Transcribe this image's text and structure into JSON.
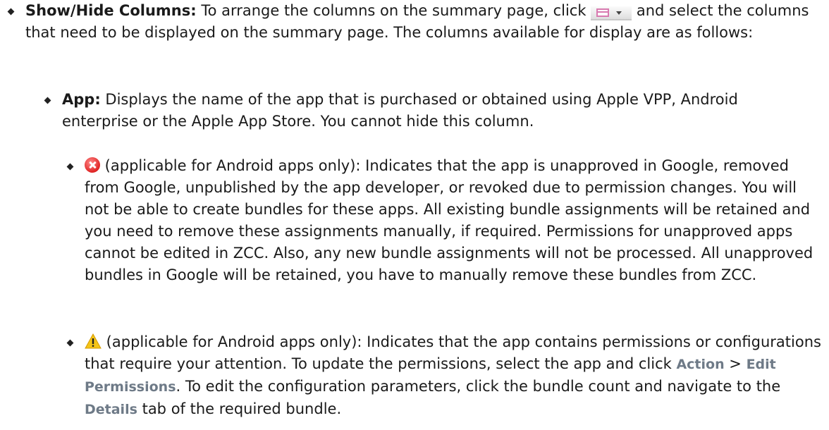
{
  "item1": {
    "term": "Show/Hide Columns:",
    "text_before_icon": " To arrange the columns on the summary page, click ",
    "text_after_icon": " and select the columns that need to be displayed on the summary page. The columns available for display are as follows:"
  },
  "item2": {
    "term": "App:",
    "text": " Displays the name of the app that is purchased or obtained using Apple VPP, Android enterprise or the Apple App Store. You cannot hide this column."
  },
  "item3": {
    "text": " (applicable for Android apps only): Indicates that the app is unapproved in Google, removed from Google, unpublished by the app developer, or revoked due to permission changes. You will not be able to create bundles for these apps. All existing bundle assignments will be retained and you need to remove these assignments manually, if required. Permissions for unapproved apps cannot be edited in ZCC. Also, any new bundle assignments will not be processed. All unapproved bundles in Google will be retained, you have to manually remove these bundles from ZCC."
  },
  "item4": {
    "text_a": " (applicable for Android apps only): Indicates that the app contains permissions or configurations that require your attention. To update the permissions, select the app and click ",
    "ui_action": "Action",
    "sep": " > ",
    "ui_edit": "Edit Permissions",
    "text_b": ". To edit the configuration parameters, click the bundle count and navigate to the ",
    "ui_details": "Details",
    "text_c": " tab of the required bundle."
  },
  "icons": {
    "columns": "column-chooser-icon",
    "error": "error-x-icon",
    "warning": "warning-triangle-icon"
  }
}
